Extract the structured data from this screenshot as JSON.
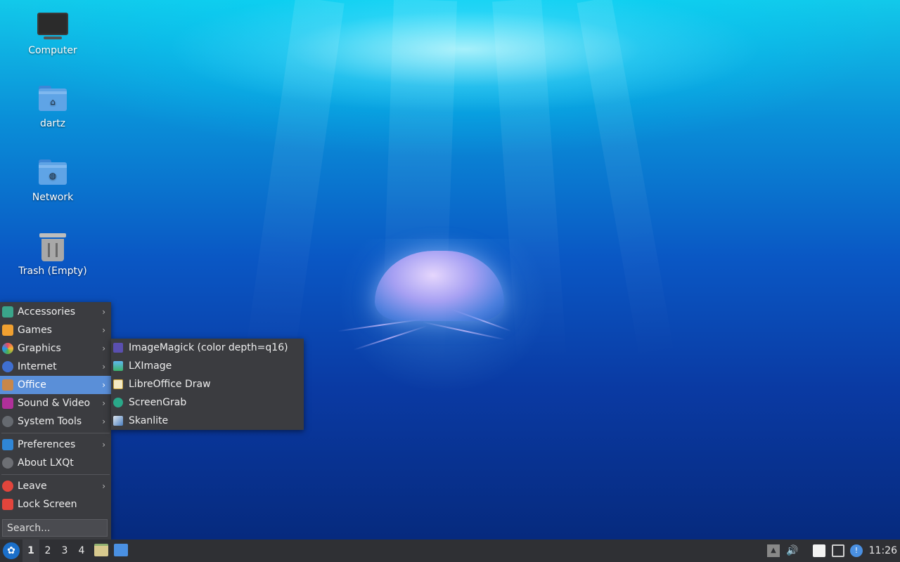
{
  "desktop": {
    "icons": [
      {
        "label": "Computer",
        "icon": "computer-icon"
      },
      {
        "label": "dartz",
        "icon": "home-folder-icon"
      },
      {
        "label": "Network",
        "icon": "network-folder-icon"
      },
      {
        "label": "Trash (Empty)",
        "icon": "trash-icon"
      }
    ]
  },
  "start_menu": {
    "categories": [
      {
        "label": "Accessories",
        "icon": "accessories-icon",
        "has_submenu": true
      },
      {
        "label": "Games",
        "icon": "games-icon",
        "has_submenu": true
      },
      {
        "label": "Graphics",
        "icon": "graphics-icon",
        "has_submenu": true
      },
      {
        "label": "Internet",
        "icon": "internet-icon",
        "has_submenu": true
      },
      {
        "label": "Office",
        "icon": "office-icon",
        "has_submenu": true,
        "active": true
      },
      {
        "label": "Sound & Video",
        "icon": "sound-video-icon",
        "has_submenu": true
      },
      {
        "label": "System Tools",
        "icon": "system-tools-icon",
        "has_submenu": true
      }
    ],
    "prefs": [
      {
        "label": "Preferences",
        "icon": "preferences-icon",
        "has_submenu": true
      },
      {
        "label": "About LXQt",
        "icon": "info-icon",
        "has_submenu": false
      }
    ],
    "session": [
      {
        "label": "Leave",
        "icon": "power-icon",
        "has_submenu": true
      },
      {
        "label": "Lock Screen",
        "icon": "lock-icon",
        "has_submenu": false
      }
    ],
    "search_placeholder": "Search...",
    "arrow": "›"
  },
  "submenu": {
    "items": [
      {
        "label": "ImageMagick (color depth=q16)",
        "icon": "imagemagick-icon"
      },
      {
        "label": "LXImage",
        "icon": "lximage-icon"
      },
      {
        "label": "LibreOffice Draw",
        "icon": "libreoffice-draw-icon"
      },
      {
        "label": "ScreenGrab",
        "icon": "screengrab-icon"
      },
      {
        "label": "Skanlite",
        "icon": "skanlite-icon"
      }
    ]
  },
  "taskbar": {
    "workspaces": [
      "1",
      "2",
      "3",
      "4"
    ],
    "active_workspace": "1",
    "clock": "11:26"
  },
  "colors": {
    "menu_bg": "#3b3c40",
    "highlight": "#5a8fd8",
    "taskbar_bg": "#2f3034"
  }
}
